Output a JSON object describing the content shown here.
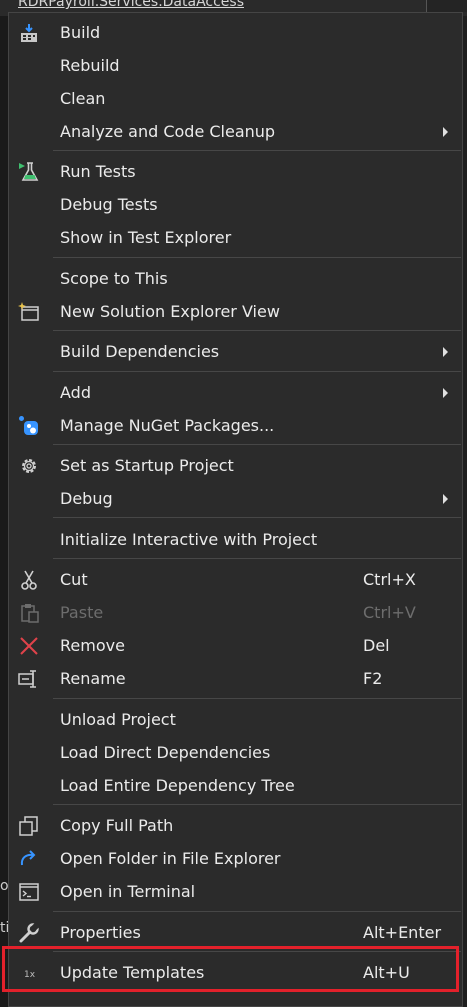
{
  "background": {
    "title": "RDRPayroll.Services.DataAccess",
    "frag1": "or",
    "frag2": "ti"
  },
  "menu": {
    "build": "Build",
    "rebuild": "Rebuild",
    "clean": "Clean",
    "analyze": "Analyze and Code Cleanup",
    "run_tests": "Run Tests",
    "debug_tests": "Debug Tests",
    "show_test_explorer": "Show in Test Explorer",
    "scope_to_this": "Scope to This",
    "new_solution_view": "New Solution Explorer View",
    "build_dependencies": "Build Dependencies",
    "add": "Add",
    "manage_nuget": "Manage NuGet Packages...",
    "set_startup": "Set as Startup Project",
    "debug": "Debug",
    "init_interactive": "Initialize Interactive with Project",
    "cut": "Cut",
    "cut_shortcut": "Ctrl+X",
    "paste": "Paste",
    "paste_shortcut": "Ctrl+V",
    "remove": "Remove",
    "remove_shortcut": "Del",
    "rename": "Rename",
    "rename_shortcut": "F2",
    "unload_project": "Unload Project",
    "load_direct": "Load Direct Dependencies",
    "load_entire": "Load Entire Dependency Tree",
    "copy_full_path": "Copy Full Path",
    "open_folder": "Open Folder in File Explorer",
    "open_terminal": "Open in Terminal",
    "properties": "Properties",
    "properties_shortcut": "Alt+Enter",
    "update_templates": "Update Templates",
    "update_templates_shortcut": "Alt+U"
  },
  "icons": {
    "build": "build-icon",
    "run_tests": "flask-icon",
    "new_view": "new-window-icon",
    "nuget": "nuget-icon",
    "startup": "gear-icon",
    "cut": "scissors-icon",
    "paste": "clipboard-icon",
    "remove": "close-icon",
    "rename": "rename-icon",
    "copy_path": "copy-icon",
    "open_folder": "refresh-arrow-icon",
    "terminal": "terminal-icon",
    "properties": "wrench-icon",
    "update_templates": "template-icon"
  },
  "colors": {
    "menu_bg": "#2b2b2b",
    "text": "#ebebeb",
    "disabled": "#6d6d6d",
    "highlight_border": "#e3212b",
    "accent_blue": "#3794ff",
    "accent_green": "#3fbf6f",
    "remove_red": "#e0424a"
  }
}
